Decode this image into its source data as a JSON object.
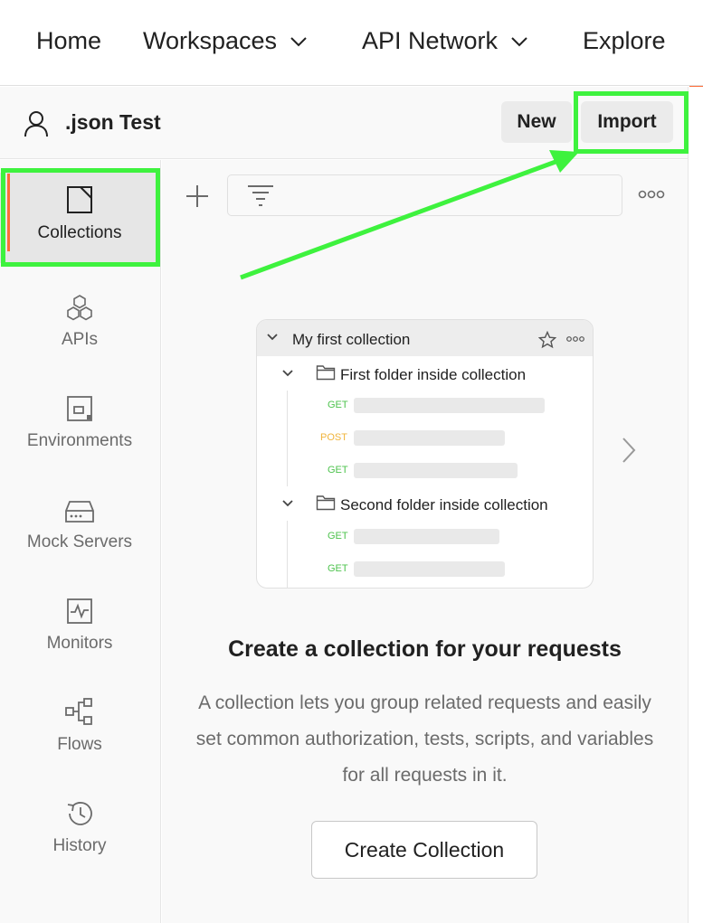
{
  "topnav": {
    "home": "Home",
    "workspaces": "Workspaces",
    "api_network": "API Network",
    "explore": "Explore"
  },
  "workspace": {
    "title": ".json Test",
    "new_label": "New",
    "import_label": "Import",
    "trail": "("
  },
  "sidebar": {
    "items": [
      {
        "label": "Collections",
        "icon": "collection-icon"
      },
      {
        "label": "APIs",
        "icon": "apis-icon"
      },
      {
        "label": "Environments",
        "icon": "environments-icon"
      },
      {
        "label": "Mock Servers",
        "icon": "mock-server-icon"
      },
      {
        "label": "Monitors",
        "icon": "monitor-icon"
      },
      {
        "label": "Flows",
        "icon": "flows-icon"
      },
      {
        "label": "History",
        "icon": "history-icon"
      }
    ]
  },
  "preview": {
    "collection_name": "My first collection",
    "folder1": "First folder inside collection",
    "folder2": "Second folder inside collection",
    "requests": [
      {
        "method": "GET",
        "color": "#4ec34e"
      },
      {
        "method": "POST",
        "color": "#f0b43c"
      },
      {
        "method": "GET",
        "color": "#4ec34e"
      },
      {
        "method": "GET",
        "color": "#4ec34e"
      },
      {
        "method": "GET",
        "color": "#4ec34e"
      }
    ]
  },
  "empty_state": {
    "title": "Create a collection for your requests",
    "description": "A collection lets you group related requests and easily set common authorization, tests, scripts, and variables for all requests in it.",
    "button": "Create Collection"
  },
  "colors": {
    "accent": "#ff6c37",
    "highlight": "#3ef23e"
  }
}
